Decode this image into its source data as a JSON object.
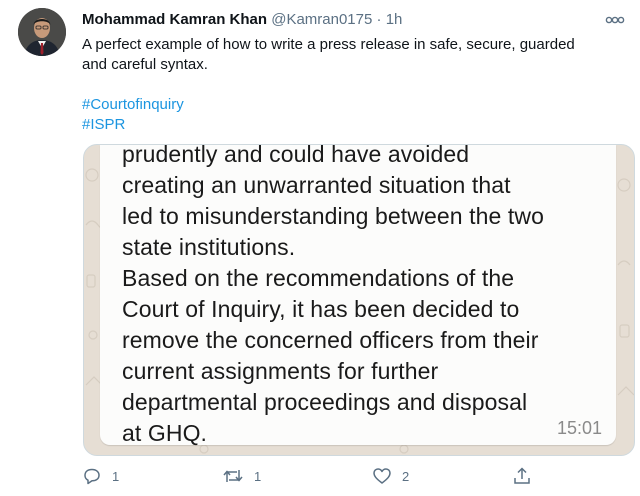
{
  "tweet": {
    "author_name": "Mohammad Kamran Khan",
    "author_handle": "@Kamran0175",
    "separator": "·",
    "time": "1h",
    "text": "A perfect example of how to write a press release in safe, secure, guarded and careful syntax.",
    "hashtags": [
      "#Courtofinquiry",
      "#ISPR"
    ]
  },
  "media": {
    "lines": [
      "prudently and could have avoided",
      "creating an unwarranted situation that",
      "led to misunderstanding between the two",
      "state institutions.",
      "Based on the recommendations of the",
      "Court of Inquiry, it has been decided to",
      "remove the concerned officers from their",
      "current assignments for further",
      "departmental proceedings and disposal",
      "at GHQ."
    ],
    "timestamp": "15:01"
  },
  "actions": {
    "reply_count": "1",
    "retweet_count": "1",
    "like_count": "2",
    "icons": [
      "reply-icon",
      "retweet-icon",
      "like-icon",
      "share-icon"
    ]
  },
  "colors": {
    "link": "#1b95e0",
    "muted": "#5b7083",
    "chat_background": "#e6ded4",
    "bubble": "#fcfcfb"
  }
}
